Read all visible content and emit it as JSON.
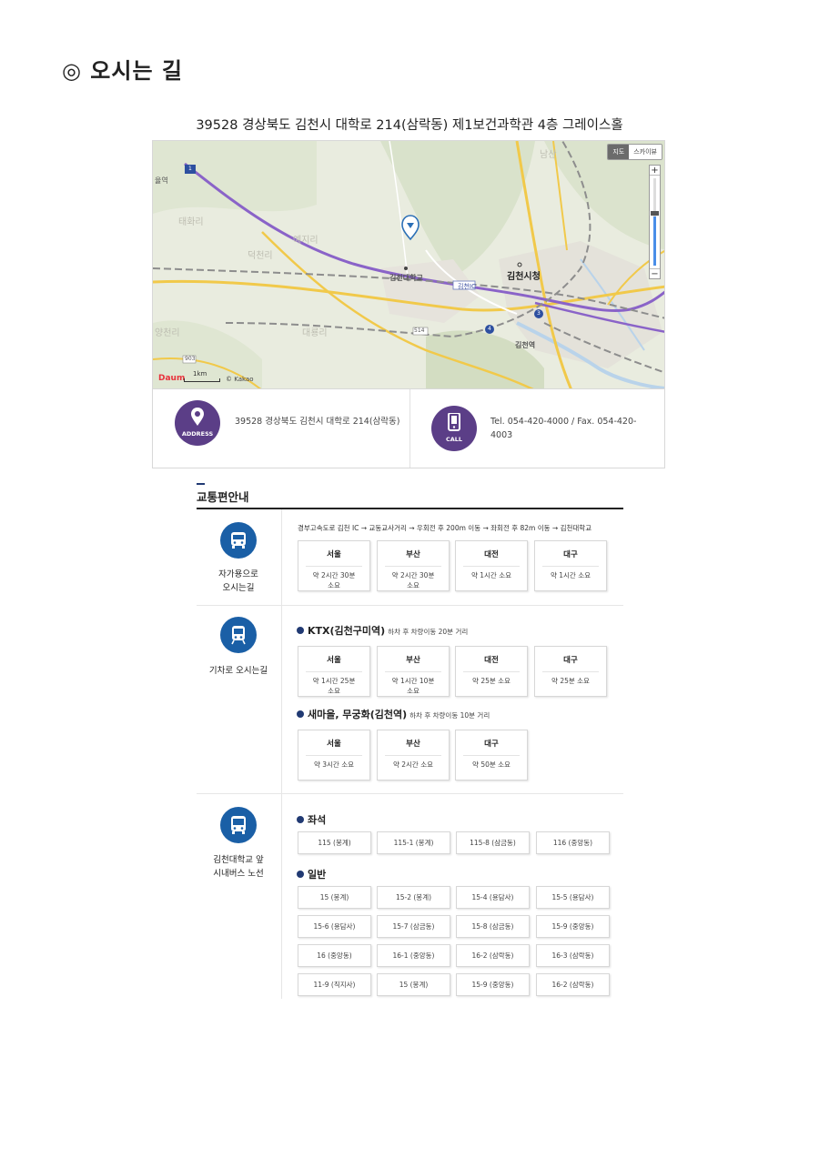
{
  "page": {
    "title": "◎ 오시는 길",
    "address_line": "39528 경상북도 김천시 대학로 214(삼락동) 제1보건과학관 4층 그레이스홀"
  },
  "map": {
    "toggle": [
      "지도",
      "스카이뷰"
    ],
    "labels": {
      "university": "김천대학교",
      "city_hall": "김천시청",
      "station": "김천역",
      "left_station": "율역",
      "ic": "김천IC",
      "faint1": "태화리",
      "faint2": "덕천리",
      "faint3": "예지리",
      "faint4": "대룡리",
      "faint5": "양천리",
      "faint6": "남산",
      "route514": "514",
      "route903": "903",
      "route1": "1",
      "route3": "3",
      "route4": "4"
    },
    "logo": "Daum",
    "scale": "1km",
    "copyright": "© Kakao",
    "zoom_plus": "+",
    "zoom_minus": "−"
  },
  "contact": {
    "address_icon_label": "ADDRESS",
    "address_text": "39528 경상북도 김천시 대학로 214(삼락동)",
    "call_icon_label": "CALL",
    "phone_line1": "Tel. 054-420-4000 / Fax. 054-420-",
    "phone_line2": "4003"
  },
  "transport": {
    "title": "교통편안내",
    "car": {
      "label_line1": "자가용으로",
      "label_line2": "오시는길",
      "route": "경부고속도로 김천 IC → 교동교사거리 → 우회전 후 200m 이동 → 좌회전 후 82m 이동 → 김천대학교",
      "cards": [
        {
          "city": "서울",
          "dur1": "약 2시간 30분",
          "dur2": "소요"
        },
        {
          "city": "부산",
          "dur1": "약 2시간 30분",
          "dur2": "소요"
        },
        {
          "city": "대전",
          "dur1": "약 1시간 소요",
          "dur2": ""
        },
        {
          "city": "대구",
          "dur1": "약 1시간 소요",
          "dur2": ""
        }
      ]
    },
    "train": {
      "label": "기차로 오시는길",
      "ktx_title": "KTX(김천구미역)",
      "ktx_note": "하차 후 차량이동 20분 거리",
      "ktx_cards": [
        {
          "city": "서울",
          "dur1": "약 1시간 25분",
          "dur2": "소요"
        },
        {
          "city": "부산",
          "dur1": "약 1시간 10분",
          "dur2": "소요"
        },
        {
          "city": "대전",
          "dur1": "약 25분 소요",
          "dur2": ""
        },
        {
          "city": "대구",
          "dur1": "약 25분 소요",
          "dur2": ""
        }
      ],
      "local_title": "새마을, 무궁화(김천역)",
      "local_note": "하차 후 차량이동 10분 거리",
      "local_cards": [
        {
          "city": "서울",
          "dur1": "약 3시간 소요",
          "dur2": ""
        },
        {
          "city": "부산",
          "dur1": "약 2시간 소요",
          "dur2": ""
        },
        {
          "city": "대구",
          "dur1": "약 50분 소요",
          "dur2": ""
        }
      ]
    },
    "bus": {
      "label_line1": "김천대학교 앞",
      "label_line2": "시내버스 노선",
      "seat_title": "좌석",
      "seat_routes": [
        "115 (봉계)",
        "115-1 (봉계)",
        "115-8 (삼금동)",
        "116 (중앙동)"
      ],
      "general_title": "일반",
      "general_routes": [
        "15 (봉계)",
        "15-2 (봉계)",
        "15-4 (용담사)",
        "15-5 (용담사)",
        "15-6 (용담사)",
        "15-7 (삼금동)",
        "15-8 (삼금동)",
        "15-9 (중앙동)",
        "16 (중앙동)",
        "16-1 (중앙동)",
        "16-2 (삼락동)",
        "16-3 (삼락동)",
        "11-9 (직지사)",
        "15 (봉계)",
        "15-9 (중앙동)",
        "16-2 (삼락동)"
      ]
    }
  },
  "colors": {
    "purple": "#5b3e87",
    "blue": "#1a5fa6",
    "navy": "#213a73",
    "rail_purple": "#8a63c8"
  }
}
